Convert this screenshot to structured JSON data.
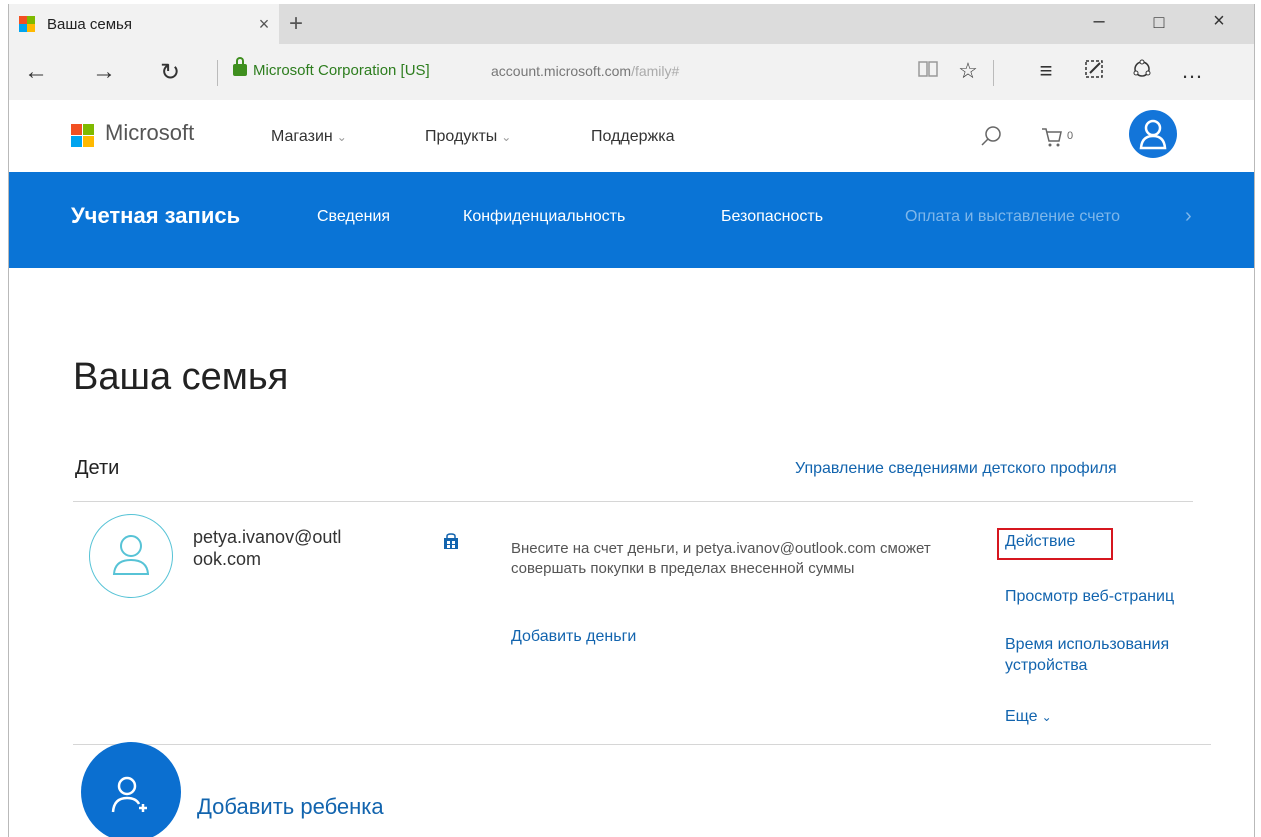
{
  "browser": {
    "tab_title": "Ваша семья",
    "tab_close": "×",
    "new_tab": "+",
    "window_controls": {
      "minimize": "–",
      "maximize": "□",
      "close": "×"
    },
    "nav": {
      "back": "←",
      "forward": "→",
      "refresh": "↻"
    },
    "address": {
      "certificate": "Microsoft Corporation [US]",
      "url_domain": "account.microsoft.com",
      "url_path": "/family#"
    },
    "toolbar_icons": [
      "reading-view-icon",
      "favorites-star-icon",
      "hub-icon",
      "web-note-icon",
      "share-icon",
      "more-icon"
    ]
  },
  "ms_header": {
    "logo_text": "Microsoft",
    "logo_colors": [
      "#f25022",
      "#7fba00",
      "#00a4ef",
      "#ffb900"
    ],
    "nav": [
      {
        "label": "Магазин",
        "has_dropdown": true
      },
      {
        "label": "Продукты",
        "has_dropdown": true
      },
      {
        "label": "Поддержка",
        "has_dropdown": false
      }
    ],
    "cart_count": "0"
  },
  "account_nav": {
    "title": "Учетная запись",
    "items": [
      "Сведения",
      "Конфиденциальность",
      "Безопасность",
      "Оплата и выставление счето"
    ],
    "scroll_right": "›",
    "bg_color": "#0a74d6"
  },
  "page": {
    "title": "Ваша семья",
    "section_children": "Дети",
    "manage_link": "Управление сведениями детского профиля"
  },
  "child": {
    "email_display": "petya.ivanov@outlook.com",
    "info_text": "Внесите на счет деньги, и petya.ivanov@outlook.com сможет совершать покупки в пределах внесенной суммы",
    "add_money": "Добавить деньги",
    "actions": {
      "activity": "Действие",
      "browsing": "Просмотр веб-страниц",
      "screen_time": "Время использования устройства",
      "more": "Еще"
    },
    "highlight_color": "#d6161f"
  },
  "add_child": {
    "label": "Добавить ребенка"
  }
}
